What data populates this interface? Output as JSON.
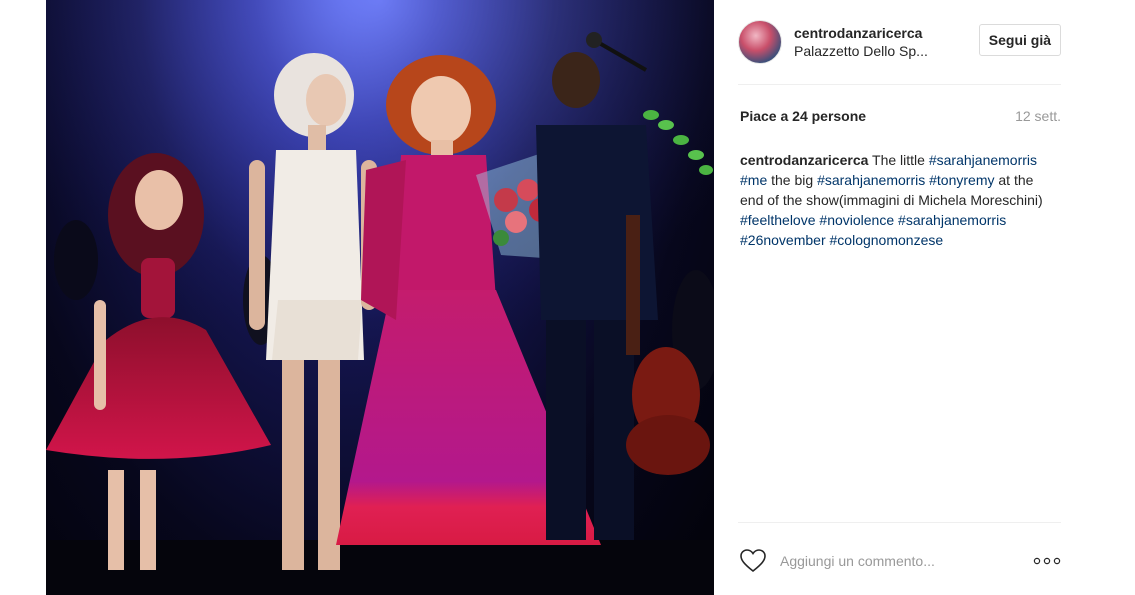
{
  "post": {
    "photo_alt": "",
    "header": {
      "username": "centrodanzaricerca",
      "location": "Palazzetto Dello Sp...",
      "follow_label": "Segui già"
    },
    "likes_text": "Piace a 24 persone",
    "time_text": "12 sett.",
    "caption": {
      "username": "centrodanzaricerca",
      "parts": [
        {
          "text": "The little ",
          "tag": false
        },
        {
          "text": "#sarahjanemorris",
          "tag": true
        },
        {
          "text": " ",
          "tag": false
        },
        {
          "text": "#me",
          "tag": true
        },
        {
          "text": " the big ",
          "tag": false
        },
        {
          "text": "#sarahjanemorris",
          "tag": true
        },
        {
          "text": " ",
          "tag": false
        },
        {
          "text": "#tonyremy",
          "tag": true
        },
        {
          "text": " at the end of the show(immagini di Michela Moreschini) ",
          "tag": false
        },
        {
          "text": "#feelthelove",
          "tag": true
        },
        {
          "text": " ",
          "tag": false
        },
        {
          "text": "#noviolence",
          "tag": true
        },
        {
          "text": " ",
          "tag": false
        },
        {
          "text": "#sarahjanemorris",
          "tag": true
        },
        {
          "text": " ",
          "tag": false
        },
        {
          "text": "#26november",
          "tag": true
        },
        {
          "text": " ",
          "tag": false
        },
        {
          "text": "#colognomonzese",
          "tag": true
        }
      ]
    },
    "comment_placeholder": "Aggiungi un commento...",
    "icons": {
      "like": "heart-icon",
      "more": "more-options-icon"
    },
    "colors": {
      "text": "#262626",
      "muted": "#999999",
      "hashtag": "#003569",
      "border": "#dbdbdb"
    }
  }
}
